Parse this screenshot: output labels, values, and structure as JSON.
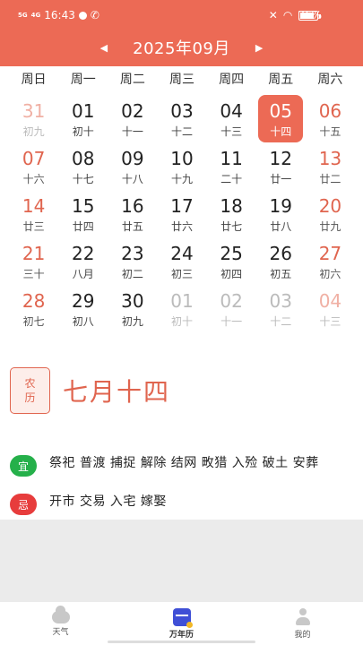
{
  "status_bar": {
    "signal_1": "5G",
    "signal_2": "4G",
    "time": "16:43",
    "battery": "76%",
    "battery_level": 0.76
  },
  "header": {
    "month_title": "2025年09月",
    "prev_arrow": "◀",
    "next_arrow": "▶"
  },
  "weekdays": [
    "周日",
    "周一",
    "周二",
    "周三",
    "周四",
    "周五",
    "周六"
  ],
  "calendar": [
    {
      "day": "31",
      "lunar": "初九",
      "other": true,
      "weekend": true
    },
    {
      "day": "01",
      "lunar": "初十",
      "other": false,
      "weekend": false
    },
    {
      "day": "02",
      "lunar": "十一",
      "other": false,
      "weekend": false
    },
    {
      "day": "03",
      "lunar": "十二",
      "other": false,
      "weekend": false
    },
    {
      "day": "04",
      "lunar": "十三",
      "other": false,
      "weekend": false
    },
    {
      "day": "05",
      "lunar": "十四",
      "other": false,
      "weekend": false,
      "selected": true
    },
    {
      "day": "06",
      "lunar": "十五",
      "other": false,
      "weekend": true
    },
    {
      "day": "07",
      "lunar": "十六",
      "other": false,
      "weekend": true
    },
    {
      "day": "08",
      "lunar": "十七",
      "other": false,
      "weekend": false
    },
    {
      "day": "09",
      "lunar": "十八",
      "other": false,
      "weekend": false
    },
    {
      "day": "10",
      "lunar": "十九",
      "other": false,
      "weekend": false
    },
    {
      "day": "11",
      "lunar": "二十",
      "other": false,
      "weekend": false
    },
    {
      "day": "12",
      "lunar": "廿一",
      "other": false,
      "weekend": false
    },
    {
      "day": "13",
      "lunar": "廿二",
      "other": false,
      "weekend": true
    },
    {
      "day": "14",
      "lunar": "廿三",
      "other": false,
      "weekend": true
    },
    {
      "day": "15",
      "lunar": "廿四",
      "other": false,
      "weekend": false
    },
    {
      "day": "16",
      "lunar": "廿五",
      "other": false,
      "weekend": false
    },
    {
      "day": "17",
      "lunar": "廿六",
      "other": false,
      "weekend": false
    },
    {
      "day": "18",
      "lunar": "廿七",
      "other": false,
      "weekend": false
    },
    {
      "day": "19",
      "lunar": "廿八",
      "other": false,
      "weekend": false
    },
    {
      "day": "20",
      "lunar": "廿九",
      "other": false,
      "weekend": true
    },
    {
      "day": "21",
      "lunar": "三十",
      "other": false,
      "weekend": true
    },
    {
      "day": "22",
      "lunar": "八月",
      "other": false,
      "weekend": false
    },
    {
      "day": "23",
      "lunar": "初二",
      "other": false,
      "weekend": false
    },
    {
      "day": "24",
      "lunar": "初三",
      "other": false,
      "weekend": false
    },
    {
      "day": "25",
      "lunar": "初四",
      "other": false,
      "weekend": false
    },
    {
      "day": "26",
      "lunar": "初五",
      "other": false,
      "weekend": false
    },
    {
      "day": "27",
      "lunar": "初六",
      "other": false,
      "weekend": true
    },
    {
      "day": "28",
      "lunar": "初七",
      "other": false,
      "weekend": true
    },
    {
      "day": "29",
      "lunar": "初八",
      "other": false,
      "weekend": false
    },
    {
      "day": "30",
      "lunar": "初九",
      "other": false,
      "weekend": false
    },
    {
      "day": "01",
      "lunar": "初十",
      "other": true,
      "weekend": false
    },
    {
      "day": "02",
      "lunar": "十一",
      "other": true,
      "weekend": false
    },
    {
      "day": "03",
      "lunar": "十二",
      "other": true,
      "weekend": false
    },
    {
      "day": "04",
      "lunar": "十三",
      "other": true,
      "weekend": true
    }
  ],
  "lunar_info": {
    "badge_line1": "农",
    "badge_line2": "历",
    "date": "七月十四"
  },
  "yi": {
    "label": "宜",
    "text": "祭祀 普渡 捕捉 解除 结网 畋猎 入殓 破土 安葬"
  },
  "ji": {
    "label": "忌",
    "text": "开市 交易 入宅 嫁娶"
  },
  "tabs": [
    {
      "label": "天气",
      "icon": "cloud-icon"
    },
    {
      "label": "万年历",
      "icon": "calendar-icon",
      "active": true
    },
    {
      "label": "我的",
      "icon": "user-icon"
    }
  ],
  "colors": {
    "accent": "#ec6a55",
    "yi": "#25b04a",
    "ji": "#e73c3c",
    "tab_active": "#3f4fd6"
  }
}
